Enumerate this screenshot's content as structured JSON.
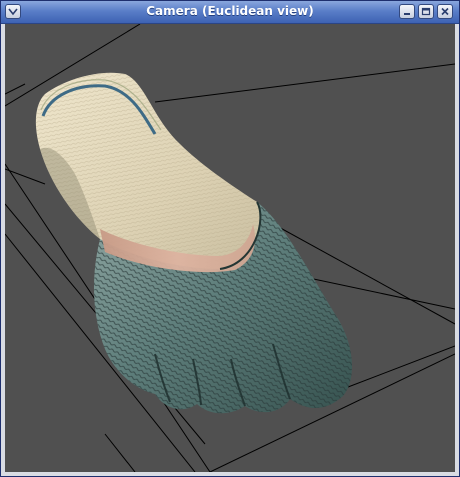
{
  "window": {
    "title": "Camera (Euclidean view)"
  },
  "titlebar_buttons": {
    "menu_icon": "chevron-down-icon",
    "minimize_icon": "minimize-icon",
    "maximize_icon": "maximize-icon",
    "close_icon": "close-icon"
  },
  "viewport": {
    "background": "#505050",
    "grid_line_color": "#000000",
    "object": "textured 3D scan of a foot (sock-covered)"
  },
  "colors": {
    "titlebar_top": "#8aa7dd",
    "titlebar_bottom": "#3d62b3",
    "sock_cream": "#e6dcc0",
    "sock_teal": "#4f6f6c",
    "skin_band": "#d4a795"
  }
}
